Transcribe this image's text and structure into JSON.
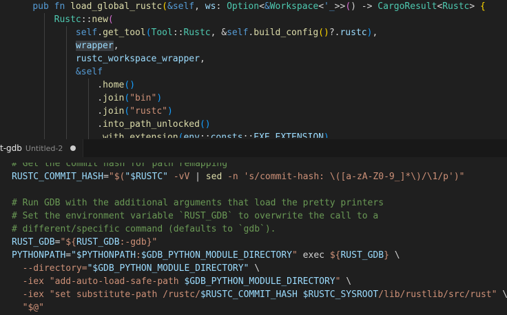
{
  "colors": {
    "keyword": "#569cd6",
    "function": "#dcdcaa",
    "type": "#4ec9b0",
    "variable": "#9cdcfe",
    "string": "#ce9178",
    "comment": "#6a9955",
    "punct": "#d4d4d4",
    "bracket1": "#ffd700",
    "bracket2": "#da70d6",
    "bracket3": "#179fff",
    "shell_text": "#d4d4d4"
  },
  "tab": {
    "name": "t-gdb",
    "description": "Untitled-2",
    "dirty_icon": "dot-icon"
  },
  "top_lines": [
    [
      [
        "    ",
        "punct"
      ],
      [
        "pub",
        "keyword"
      ],
      [
        " ",
        "punct"
      ],
      [
        "fn",
        "keyword"
      ],
      [
        " ",
        "punct"
      ],
      [
        "load_global_rustc",
        "function"
      ],
      [
        "(",
        "bracket1"
      ],
      [
        "&",
        "keyword"
      ],
      [
        "self",
        "keyword"
      ],
      [
        ", ",
        "punct"
      ],
      [
        "ws",
        "variable"
      ],
      [
        ": ",
        "punct"
      ],
      [
        "Option",
        "type"
      ],
      [
        "<",
        "punct"
      ],
      [
        "&",
        "keyword"
      ],
      [
        "Workspace",
        "type"
      ],
      [
        "<",
        "punct"
      ],
      [
        "'_",
        "keyword"
      ],
      [
        ">>",
        "punct"
      ],
      [
        "(",
        "bracket2"
      ],
      [
        ") -> ",
        "punct"
      ],
      [
        "CargoResult",
        "type"
      ],
      [
        "<",
        "punct"
      ],
      [
        "Rustc",
        "type"
      ],
      [
        "> ",
        "punct"
      ],
      [
        "{",
        "bracket1"
      ]
    ],
    [
      [
        "        ",
        "punct"
      ],
      [
        "Rustc",
        "type"
      ],
      [
        "::",
        "punct"
      ],
      [
        "new",
        "function"
      ],
      [
        "(",
        "bracket2"
      ]
    ],
    [
      [
        "            ",
        "punct"
      ],
      [
        "self",
        "keyword"
      ],
      [
        ".",
        "punct"
      ],
      [
        "get_tool",
        "function"
      ],
      [
        "(",
        "bracket3"
      ],
      [
        "Tool",
        "type"
      ],
      [
        "::",
        "punct"
      ],
      [
        "Rustc",
        "type"
      ],
      [
        ", &",
        "punct"
      ],
      [
        "self",
        "keyword"
      ],
      [
        ".",
        "punct"
      ],
      [
        "build_config",
        "function"
      ],
      [
        "()",
        "bracket1"
      ],
      [
        "?.",
        "punct"
      ],
      [
        "rustc",
        "variable"
      ],
      [
        ")",
        "bracket3"
      ],
      [
        ",",
        "punct"
      ]
    ],
    [
      [
        "            ",
        "punct"
      ],
      [
        "wrapper",
        "variable",
        "hl"
      ],
      [
        ",",
        "punct"
      ]
    ],
    [
      [
        "            ",
        "punct"
      ],
      [
        "rustc_workspace_wrapper",
        "variable"
      ],
      [
        ",",
        "punct"
      ]
    ],
    [
      [
        "            ",
        "punct"
      ],
      [
        "&",
        "keyword"
      ],
      [
        "self",
        "keyword"
      ]
    ],
    [
      [
        "                ",
        "punct"
      ],
      [
        ".",
        "punct"
      ],
      [
        "home",
        "function"
      ],
      [
        "()",
        "bracket3"
      ]
    ],
    [
      [
        "                ",
        "punct"
      ],
      [
        ".",
        "punct"
      ],
      [
        "join",
        "function"
      ],
      [
        "(",
        "bracket3"
      ],
      [
        "\"bin\"",
        "string"
      ],
      [
        ")",
        "bracket3"
      ]
    ],
    [
      [
        "                ",
        "punct"
      ],
      [
        ".",
        "punct"
      ],
      [
        "join",
        "function"
      ],
      [
        "(",
        "bracket3"
      ],
      [
        "\"rustc\"",
        "string"
      ],
      [
        ")",
        "bracket3"
      ]
    ],
    [
      [
        "                ",
        "punct"
      ],
      [
        ".",
        "punct"
      ],
      [
        "into_path_unlocked",
        "function"
      ],
      [
        "()",
        "bracket3"
      ]
    ],
    [
      [
        "                ",
        "punct"
      ],
      [
        ".",
        "punct"
      ],
      [
        "with_extension",
        "function"
      ],
      [
        "(",
        "bracket3"
      ],
      [
        "env",
        "variable"
      ],
      [
        "::",
        "punct"
      ],
      [
        "consts",
        "variable"
      ],
      [
        "::",
        "punct"
      ],
      [
        "EXE_EXTENSION",
        "variable"
      ],
      [
        ")",
        "bracket3"
      ]
    ]
  ],
  "bottom_lines": [
    [
      [
        "# Get the commit hash for path remapping",
        "comment"
      ]
    ],
    [
      [
        "RUSTC_COMMIT_HASH",
        "variable"
      ],
      [
        "=",
        "shell_text"
      ],
      [
        "\"$(",
        "string"
      ],
      [
        "\"$RUSTC\"",
        "variable"
      ],
      [
        " -vV ",
        "string"
      ],
      [
        "| ",
        "shell_text"
      ],
      [
        "sed",
        "function"
      ],
      [
        " -n ",
        "string"
      ],
      [
        "'s/commit-hash: \\([a-zA-Z0-9_]*\\)/\\1/p'",
        "string"
      ],
      [
        ")\"",
        "string"
      ]
    ],
    [
      [
        "",
        "shell_text"
      ]
    ],
    [
      [
        "# Run GDB with the additional arguments that load the pretty printers",
        "comment"
      ]
    ],
    [
      [
        "# Set the environment variable `RUST_GDB` to overwrite the call to a",
        "comment"
      ]
    ],
    [
      [
        "# different/specific command (defaults to `gdb`).",
        "comment"
      ]
    ],
    [
      [
        "RUST_GDB",
        "variable"
      ],
      [
        "=",
        "shell_text"
      ],
      [
        "\"${",
        "string"
      ],
      [
        "RUST_GDB",
        "variable"
      ],
      [
        ":-gdb}\"",
        "string"
      ]
    ],
    [
      [
        "PYTHONPATH",
        "variable"
      ],
      [
        "=",
        "shell_text"
      ],
      [
        "\"$PYTHONPATH",
        "variable"
      ],
      [
        ":",
        "string"
      ],
      [
        "$GDB_PYTHON_MODULE_DIRECTORY",
        "variable"
      ],
      [
        "\"",
        "string"
      ],
      [
        " exec ",
        "shell_text"
      ],
      [
        "${",
        "string"
      ],
      [
        "RUST_GDB",
        "variable"
      ],
      [
        "}",
        "string"
      ],
      [
        " \\",
        "shell_text"
      ]
    ],
    [
      [
        "  ",
        "shell_text"
      ],
      [
        "--directory=",
        "string"
      ],
      [
        "\"$GDB_PYTHON_MODULE_DIRECTORY\"",
        "variable"
      ],
      [
        " \\",
        "shell_text"
      ]
    ],
    [
      [
        "  ",
        "shell_text"
      ],
      [
        "-iex ",
        "string"
      ],
      [
        "\"add-auto-load-safe-path ",
        "string"
      ],
      [
        "$GDB_PYTHON_MODULE_DIRECTORY",
        "variable"
      ],
      [
        "\"",
        "string"
      ],
      [
        " \\",
        "shell_text"
      ]
    ],
    [
      [
        "  ",
        "shell_text"
      ],
      [
        "-iex ",
        "string"
      ],
      [
        "\"set substitute-path /rustc/",
        "string"
      ],
      [
        "$RUSTC_COMMIT_HASH",
        "variable"
      ],
      [
        " ",
        "string"
      ],
      [
        "$RUSTC_SYSROOT",
        "variable"
      ],
      [
        "/lib/rustlib/src/rust\"",
        "string"
      ],
      [
        " \\",
        "shell_text"
      ]
    ],
    [
      [
        "  ",
        "shell_text"
      ],
      [
        "\"$@\"",
        "string"
      ]
    ]
  ]
}
